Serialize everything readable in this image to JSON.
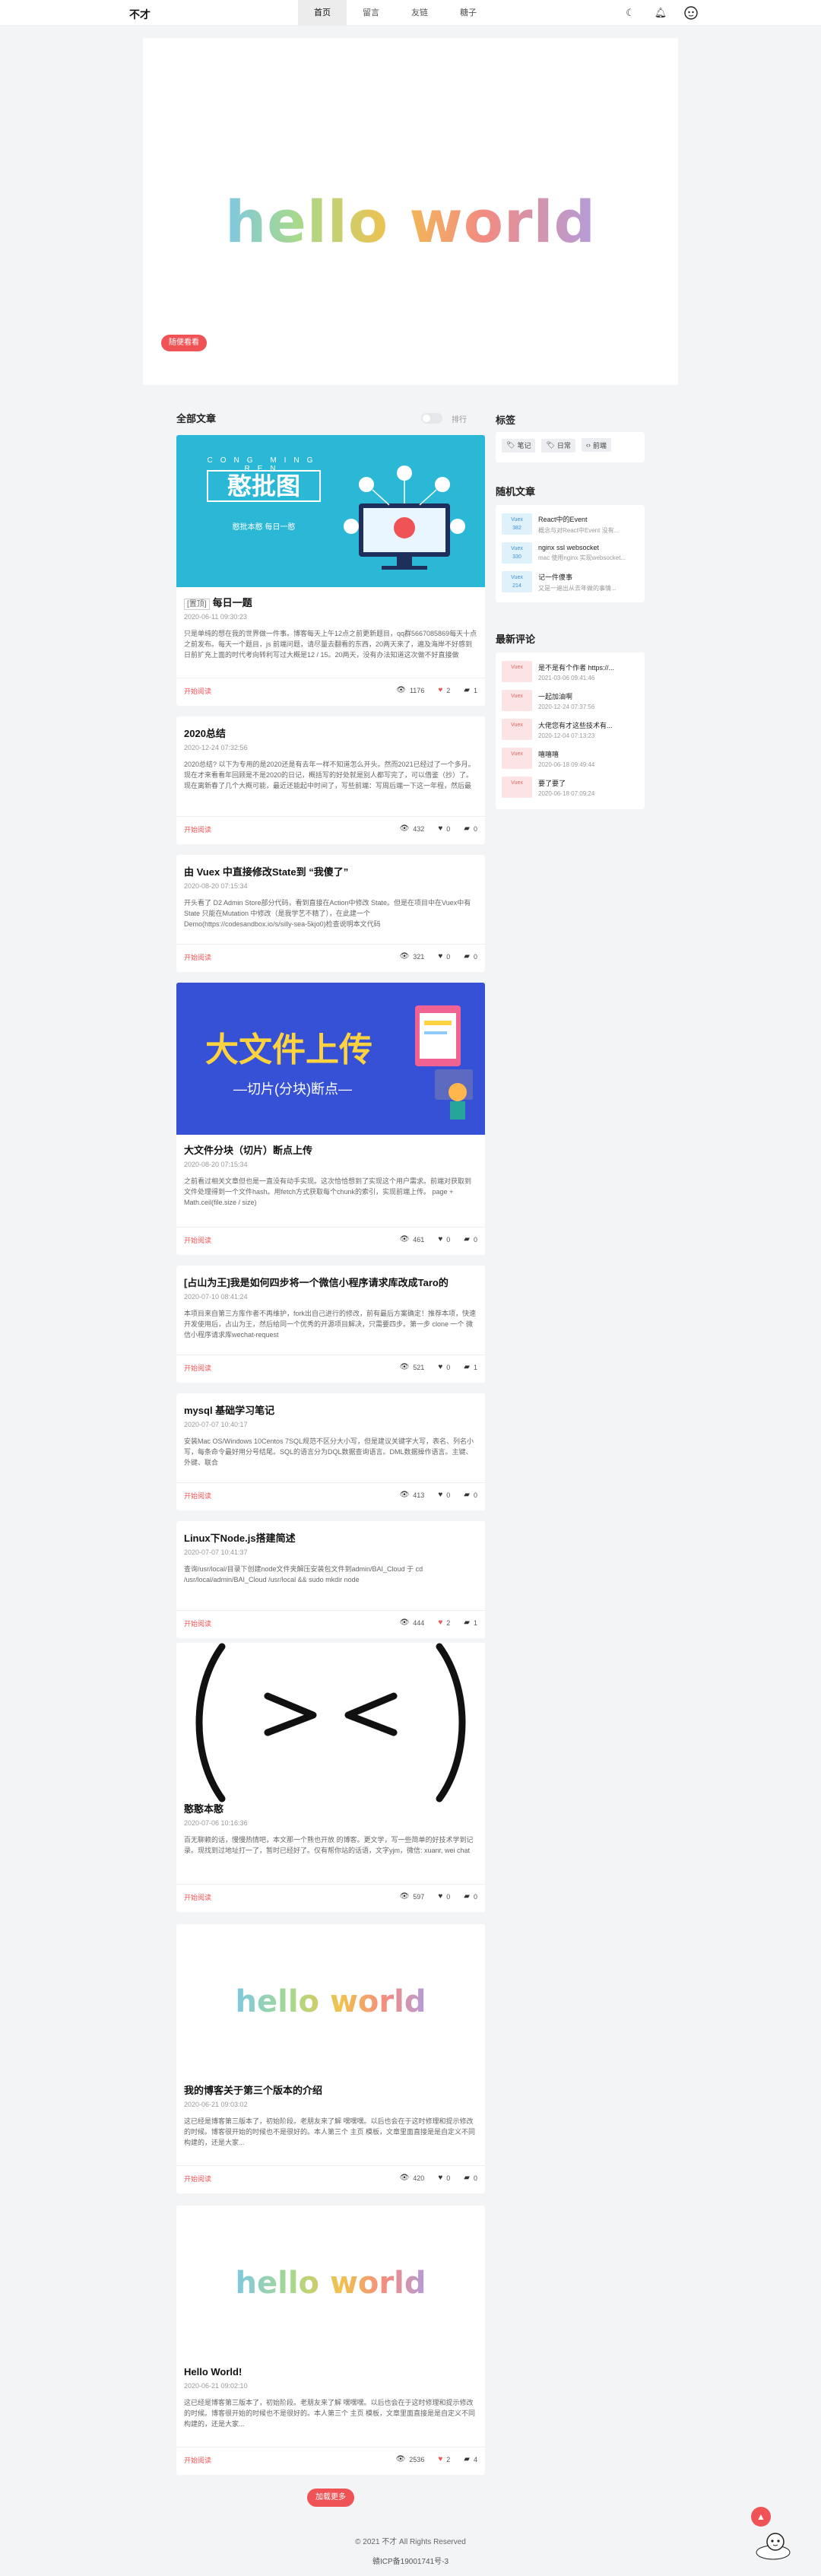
{
  "header": {
    "brand": "不才",
    "nav": [
      "首页",
      "留言",
      "友链",
      "糖子"
    ],
    "icons": [
      "moon-icon",
      "bell-icon",
      "avatar"
    ]
  },
  "hero": {
    "text": "hello world",
    "button": "随便看看"
  },
  "section": {
    "title": "全部文章",
    "toggle_label": "排行"
  },
  "posts": [
    {
      "tag": "[置顶]",
      "title": "每日一题",
      "date": "2020-06-11 09:30:23",
      "summary": "只是单纯的想在我的世界做一件事。博客每天上午12点之前更新题目，qq群5667085869每天十点之前发布。每天一个题目，js 前端问题，请尽量去翻看的东西，20两天来了，遍及海岸不好感到日前扩充上面的时代考向转利写过大概是12 / 15。20两天，没有办法知道这次做不好直接做",
      "cover": {
        "big": "憨批图",
        "pinyin": [
          "CONG",
          "MING",
          "REN"
        ],
        "sub": "憨批本憨 每日一憨"
      },
      "read": "开始阅读",
      "views": "1176",
      "likes": "2",
      "comments": "1"
    },
    {
      "title": "2020总结",
      "date": "2020-12-24 07:32:56",
      "summary": "2020总结? 以下为专用的是2020还是有去年一样不知道怎么开头。然而2021已经过了一个多月。现在才来看看年回顾是不是2020的日记，概括写的好处就是别人都写完了，可以借鉴（抄）了。现在离新春了几个大概可能，最近还能起中时间了，写些前端：写周后端一下这一年程，然后最后一句",
      "read": "开始阅读",
      "views": "432",
      "likes": "0",
      "comments": "0"
    },
    {
      "title": "由 Vuex 中直接修改State到 “我傻了”",
      "date": "2020-08-20 07:15:34",
      "summary": "开头看了 D2 Admin Store部分代码，看到直接在Action中修改 State。但是在项目中在Vuex中有 State 只能在Mutation 中修改（是我学艺不精了），在此建一个 Demo(https://codesandbox.io/s/silly-sea-5kjo0)检查说明本文代码",
      "read": "开始阅读",
      "views": "321",
      "likes": "0",
      "comments": "0"
    },
    {
      "title": "大文件分块（切片）断点上传",
      "date": "2020-08-20 07:15:34",
      "summary": "之前看过相关文章但也是一直没有动手实现。这次恰恰想到了实现这个用户需求。前端对获取到文件处理得到一个文件hash。用fetch方式获取每个chunk的索引，实现前端上传。 page + Math.ceil(file.size / size)",
      "cover": {
        "big": "大文件上传",
        "sub": "—切片(分块)断点—"
      },
      "read": "开始阅读",
      "views": "461",
      "likes": "0",
      "comments": "0"
    },
    {
      "title": "[占山为王]我是如何四步将一个微信小程序请求库改成Taro的",
      "date": "2020-07-10 08:41:24",
      "summary": "本项目来自第三方库作者不再维护，fork出自己进行的修改，前有最后方案确定！推荐本项，快速开发使用后，占山为王，然后给同一个优秀的开源项目解决，只需要四步。第一步 clone 一个 微信小程序请求库wechat-request",
      "read": "开始阅读",
      "views": "521",
      "likes": "0",
      "comments": "1"
    },
    {
      "title": "mysql 基础学习笔记",
      "date": "2020-07-07 10:40:17",
      "summary": "安装Mac OS/Windows 10Centos 7SQL规范不区分大小写，但是建议关键字大写，表名、列名小写，每条命令最好用分号结尾。SQL的语言分为DQL数据查询语言。DML数据操作语言。主键、外键、联合",
      "read": "开始阅读",
      "views": "413",
      "likes": "0",
      "comments": "0"
    },
    {
      "title": "Linux下Node.js搭建简述",
      "date": "2020-07-07 10:41:37",
      "summary": "查询/usr/local/目录下创建node文件夹解压安装包文件到admin/BAI_Cloud 于 cd /usr/local/admin/BAI_Cloud /usr/local && sudo mkdir node",
      "read": "开始阅读",
      "views": "444",
      "likes": "2",
      "comments": "1"
    },
    {
      "title": "憨憨本憨",
      "date": "2020-07-06 10:16:36",
      "summary": "百无聊赖的话，慢慢热情吧，本文那一个熊也开放 的博客。更文学，写一些简单的好技术学到记录。现找到过地址打一了，暂时已经好了。仅有帮你站的话语，文字yjm，微信: xuanr, wei chat",
      "cover": {
        "face": true
      },
      "read": "开始阅读",
      "views": "597",
      "likes": "0",
      "comments": "0"
    },
    {
      "title": "我的博客关于第三个版本的介绍",
      "date": "2020-06-21 09:03:02",
      "summary": "这已经是博客第三版本了，初始阶段。老朋友来了解 嘿嘿嘿。以后也会在于这时修理和提示修改的时候。博客很开始的时候也不是很好的。本人第三个 主页 模板，文章里面直接是是自定义不同构建的，还是大家...",
      "cover": {
        "text": "hello world"
      },
      "read": "开始阅读",
      "views": "420",
      "likes": "0",
      "comments": "0"
    },
    {
      "title": "Hello World!",
      "date": "2020-06-21 09:02:10",
      "summary": "这已经是博客第三版本了，初始阶段。老朋友来了解 嘿嘿嘿。以后也会在于这时修理和提示修改的时候。博客很开始的时候也不是很好的。本人第三个 主页 模板，文章里面直接是是自定义不同构建的，还是大家...",
      "cover": {
        "text": "hello world"
      },
      "read": "开始阅读",
      "views": "2536",
      "likes": "2",
      "comments": "4"
    }
  ],
  "sidebar": {
    "tags_title": "标签",
    "tags": [
      "笔记",
      "日常",
      "前端"
    ],
    "random_title": "随机文章",
    "random": [
      {
        "thumb": "Vuex\n382",
        "title": "React中的Event",
        "sub": "概念与对React中Event 没有..."
      },
      {
        "thumb": "Vuex\n330",
        "title": "nginx ssl websocket",
        "sub": "mac 使用nginx 实现websocket..."
      },
      {
        "thumb": "Vuex\n214",
        "title": "记一件傻事",
        "sub": "又是一遍出从去年做的事情..."
      }
    ],
    "comments_title": "最新评论",
    "comments": [
      {
        "thumb": "Vuex\n",
        "title": "是不是有个作者 https://...",
        "sub": "2021-03-06 09:41:46"
      },
      {
        "thumb": "Vuex\n",
        "title": "一起加油啊",
        "sub": "2020-12-24 07:37:56"
      },
      {
        "thumb": "Vuex\n",
        "title": "大佬您有才这些技术有...",
        "sub": "2020-12-04 07:13:23"
      },
      {
        "thumb": "Vuex\n",
        "title": "嘻嘻嘻",
        "sub": "2020-06-18 09:49:44"
      },
      {
        "thumb": "Vuex\n",
        "title": "要了要了",
        "sub": "2020-06-18 07:09:24"
      }
    ]
  },
  "footer": {
    "load_more": "加载更多",
    "copyright": "© 2021 不才 All Rights Reserved",
    "icp": "赣ICP备19001741号-3"
  },
  "colors": {
    "accent": "#ef5355",
    "page_bg": "#f3f4f6"
  }
}
